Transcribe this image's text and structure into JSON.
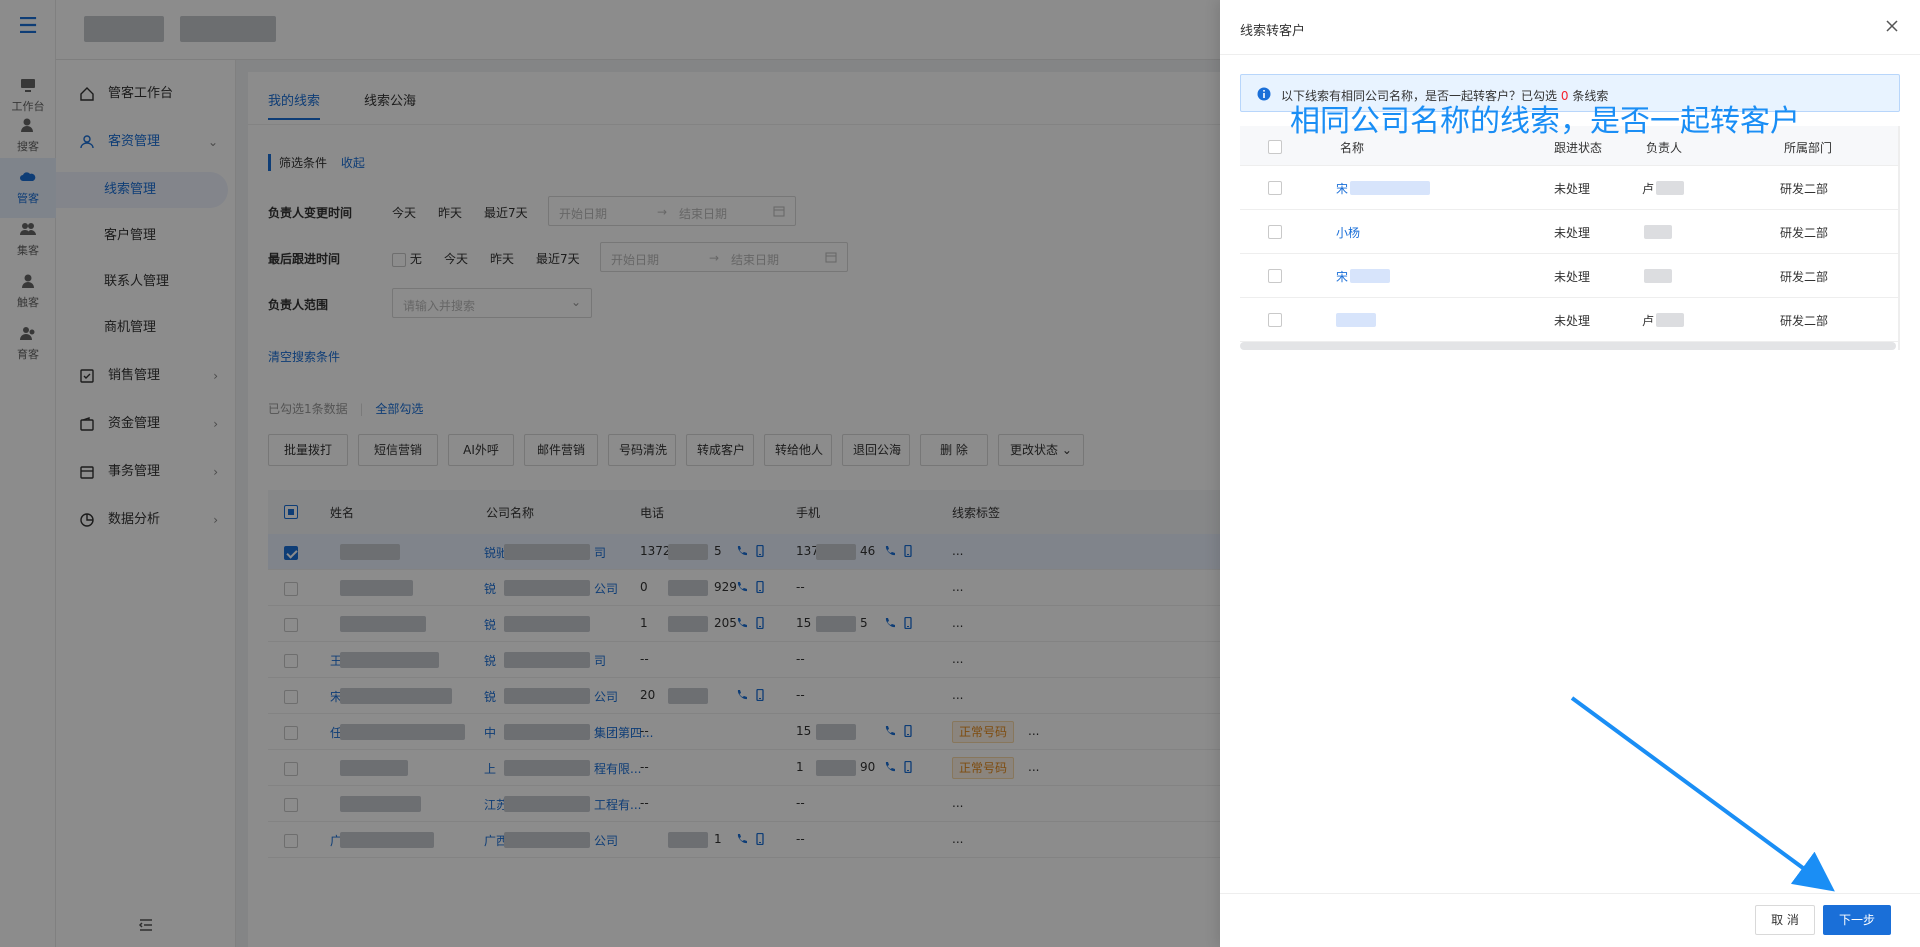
{
  "rail": {
    "items": [
      {
        "label": "工作台"
      },
      {
        "label": "搜客"
      },
      {
        "label": "管客"
      },
      {
        "label": "集客"
      },
      {
        "label": "触客"
      },
      {
        "label": "育客"
      }
    ]
  },
  "nav": {
    "items": [
      {
        "label": "管客工作台"
      },
      {
        "label": "客资管理"
      },
      {
        "label": "线索管理"
      },
      {
        "label": "客户管理"
      },
      {
        "label": "联系人管理"
      },
      {
        "label": "商机管理"
      },
      {
        "label": "销售管理"
      },
      {
        "label": "资金管理"
      },
      {
        "label": "事务管理"
      },
      {
        "label": "数据分析"
      }
    ]
  },
  "tabs": [
    "我的线索",
    "线索公海"
  ],
  "filter": {
    "title": "筛选条件",
    "collapse": "收起",
    "row1": {
      "label": "负责人变更时间",
      "opts": [
        "今天",
        "昨天",
        "最近7天"
      ],
      "start": "开始日期",
      "end": "结束日期"
    },
    "row2": {
      "label": "最后跟进时间",
      "none": "无",
      "opts": [
        "今天",
        "昨天",
        "最近7天"
      ],
      "start": "开始日期",
      "end": "结束日期"
    },
    "row3": {
      "label": "负责人范围",
      "placeholder": "请输入并搜索"
    },
    "clear": "清空搜索条件"
  },
  "selection": {
    "info": "已勾选1条数据",
    "select_all": "全部勾选"
  },
  "toolbar": [
    "批量拨打",
    "短信营销",
    "AI外呼",
    "邮件营销",
    "号码清洗",
    "转成客户",
    "转给他人",
    "退回公海",
    "删 除",
    "更改状态"
  ],
  "table": {
    "headers": [
      "姓名",
      "公司名称",
      "电话",
      "手机",
      "线索标签"
    ],
    "rows": [
      {
        "name": "",
        "company": "锐驰",
        "company_end": "司",
        "phone": "1372",
        "phone_end": "5",
        "mobile": "137",
        "mobile_end": "46",
        "tag": "",
        "tail": "..."
      },
      {
        "name": "",
        "company": "锐",
        "company_end": "公司",
        "phone": "0",
        "phone_end": "929",
        "mobile": "--",
        "mobile_end": "",
        "tag": "",
        "tail": "..."
      },
      {
        "name": "",
        "company": "锐",
        "company_end": "",
        "phone": "1",
        "phone_end": "205",
        "mobile": "15",
        "mobile_end": "5",
        "tag": "",
        "tail": "..."
      },
      {
        "name": "王",
        "company": "锐",
        "company_end": "司",
        "phone": "--",
        "phone_end": "",
        "mobile": "--",
        "mobile_end": "",
        "tag": "",
        "tail": "..."
      },
      {
        "name": "宋",
        "company": "锐",
        "company_end": "公司",
        "phone": "20",
        "phone_end": "",
        "mobile": "--",
        "mobile_end": "",
        "tag": "",
        "tail": "..."
      },
      {
        "name": "任",
        "company": "中",
        "company_end": "集团第四...",
        "phone": "--",
        "phone_end": "",
        "mobile": "15",
        "mobile_end": "",
        "tag": "正常号码",
        "tail": "..."
      },
      {
        "name": "",
        "company": "上",
        "company_end": "程有限...",
        "phone": "--",
        "phone_end": "",
        "mobile": "1",
        "mobile_end": "90",
        "tag": "正常号码",
        "tail": "..."
      },
      {
        "name": "",
        "company": "江苏",
        "company_end": "工程有...",
        "phone": "--",
        "phone_end": "",
        "mobile": "--",
        "mobile_end": "",
        "tag": "",
        "tail": "..."
      },
      {
        "name": "广西",
        "company": "广西",
        "company_end": "公司",
        "phone": "",
        "phone_end": "1",
        "mobile": "--",
        "mobile_end": "",
        "tag": "",
        "tail": "..."
      }
    ]
  },
  "drawer": {
    "title": "线索转客户",
    "alert_pre": "以下线索有相同公司名称，是否一起转客户？已勾选",
    "alert_count": "0",
    "alert_post": "条线索",
    "annotation": "相同公司名称的线索，是否一起转客户",
    "headers": [
      "名称",
      "跟进状态",
      "负责人",
      "所属部门"
    ],
    "rows": [
      {
        "name": "宋",
        "status": "未处理",
        "owner": "卢",
        "dept": "研发二部"
      },
      {
        "name": "小杨",
        "status": "未处理",
        "owner": "",
        "dept": "研发二部"
      },
      {
        "name": "宋",
        "status": "未处理",
        "owner": "",
        "dept": "研发二部"
      },
      {
        "name": "",
        "status": "未处理",
        "owner": "卢",
        "dept": "研发二部"
      }
    ],
    "cancel": "取 消",
    "next": "下一步"
  },
  "colors": {
    "primary": "#1a6fd8",
    "annotation": "#1a8ef5",
    "tag": "#e58b1d",
    "alert_count": "#f5222d"
  }
}
